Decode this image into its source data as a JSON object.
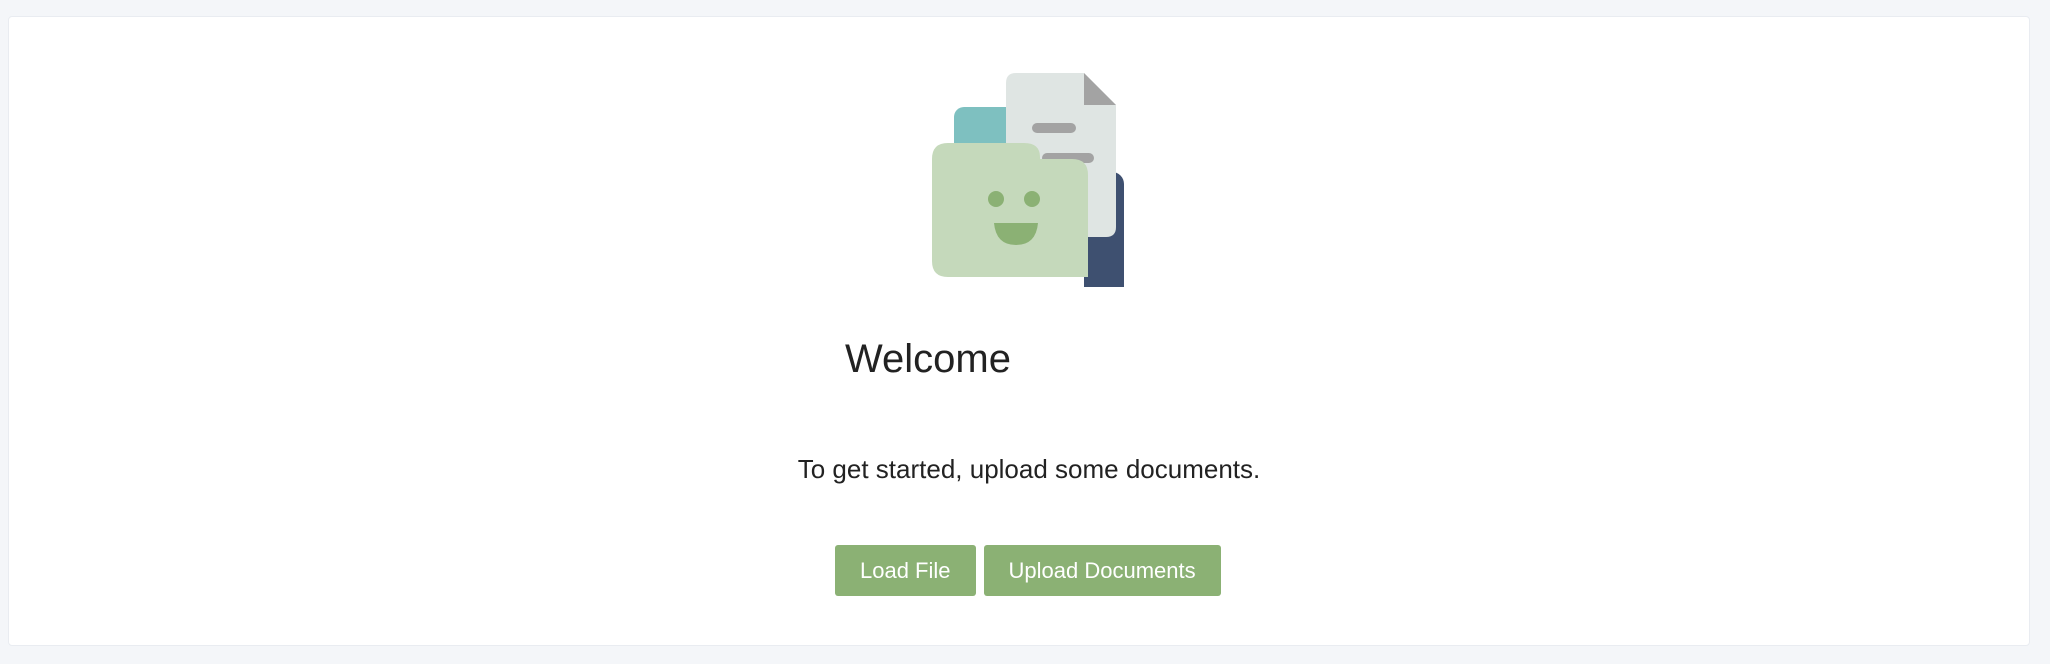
{
  "welcome": {
    "title": "Welcome",
    "subtitle": "To get started, upload some documents."
  },
  "actions": {
    "load_file_label": "Load File",
    "upload_documents_label": "Upload Documents"
  },
  "colors": {
    "button_bg": "#8bb174",
    "folder_front": "#c5d9bb",
    "folder_face": "#8bb174",
    "folder_back": "#7ec0c0",
    "paper": "#dfe5e3",
    "paper_lines": "#a3a3a3",
    "dark_folder": "#3e5070"
  },
  "icons": {
    "illustration": "smiling-folder-with-documents-icon"
  }
}
